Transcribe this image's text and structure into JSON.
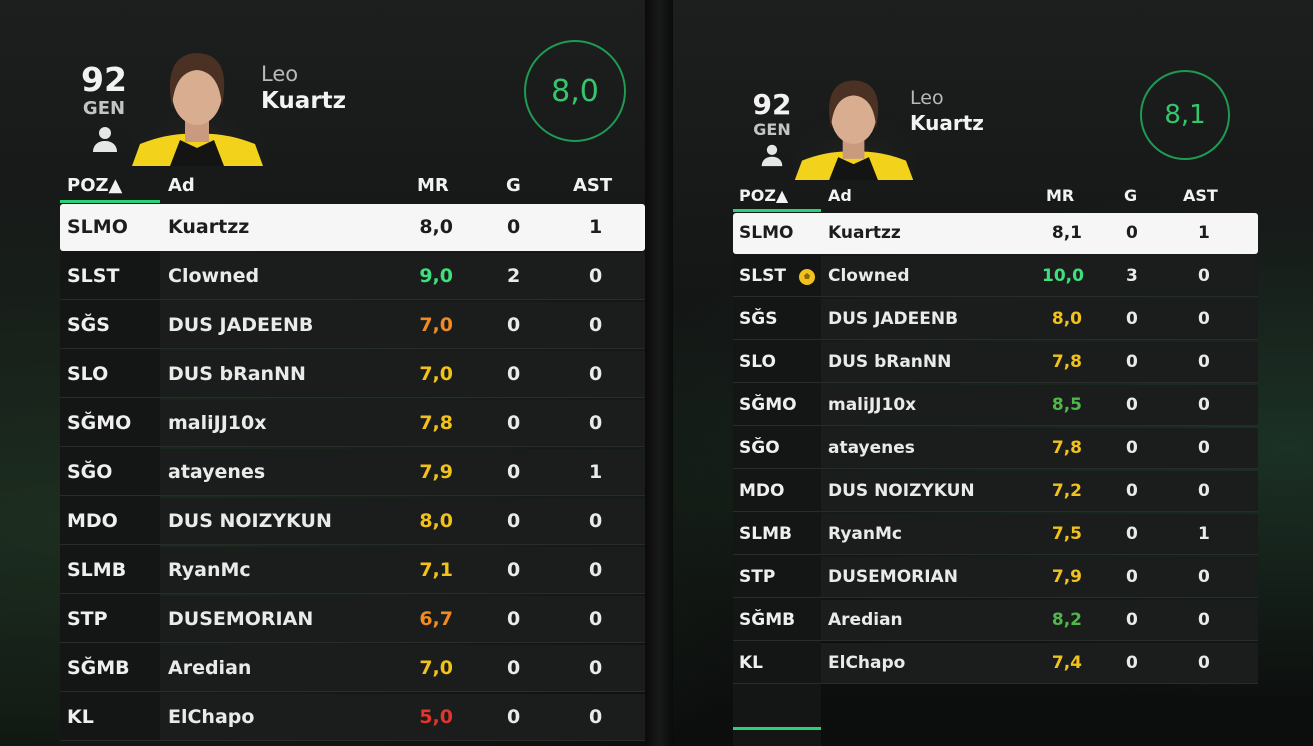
{
  "colors": {
    "rating_green_bright": "#3ee07e",
    "rating_green": "#4fb84a",
    "rating_yellow": "#f1c21b",
    "rating_orange": "#f08a22",
    "rating_red": "#e2352d",
    "accent": "#2ad07a"
  },
  "panels": [
    {
      "player": {
        "overall": "92",
        "overall_label": "GEN",
        "first_name": "Leo",
        "last_name": "Kuartz",
        "match_rating": "8,0"
      },
      "columns": {
        "pos": "POZ▲",
        "name": "Ad",
        "rating": "MR",
        "goals": "G",
        "assists": "AST"
      },
      "rows": [
        {
          "pos": "SLMO",
          "name": "Kuartzz",
          "rating": "8,0",
          "rating_color": "sel",
          "goals": "0",
          "assists": "1",
          "selected": true
        },
        {
          "pos": "SLST",
          "name": "Clowned",
          "rating": "9,0",
          "rating_color": "#3ee07e",
          "goals": "2",
          "assists": "0"
        },
        {
          "pos": "SĞS",
          "name": "DUS JADEENB",
          "rating": "7,0",
          "rating_color": "#f08a22",
          "goals": "0",
          "assists": "0"
        },
        {
          "pos": "SLO",
          "name": "DUS bRanNN",
          "rating": "7,0",
          "rating_color": "#f1c21b",
          "goals": "0",
          "assists": "0"
        },
        {
          "pos": "SĞMO",
          "name": "maliJJ10x",
          "rating": "7,8",
          "rating_color": "#f1c21b",
          "goals": "0",
          "assists": "0"
        },
        {
          "pos": "SĞO",
          "name": "atayenes",
          "rating": "7,9",
          "rating_color": "#f1c21b",
          "goals": "0",
          "assists": "1"
        },
        {
          "pos": "MDO",
          "name": "DUS NOIZYKUN",
          "rating": "8,0",
          "rating_color": "#f1c21b",
          "goals": "0",
          "assists": "0"
        },
        {
          "pos": "SLMB",
          "name": "RyanMc",
          "rating": "7,1",
          "rating_color": "#f1c21b",
          "goals": "0",
          "assists": "0"
        },
        {
          "pos": "STP",
          "name": "DUSEMORIAN",
          "rating": "6,7",
          "rating_color": "#f08a22",
          "goals": "0",
          "assists": "0"
        },
        {
          "pos": "SĞMB",
          "name": "Aredian",
          "rating": "7,0",
          "rating_color": "#f1c21b",
          "goals": "0",
          "assists": "0"
        },
        {
          "pos": "KL",
          "name": "ElChapo",
          "rating": "5,0",
          "rating_color": "#e2352d",
          "goals": "0",
          "assists": "0"
        }
      ]
    },
    {
      "player": {
        "overall": "92",
        "overall_label": "GEN",
        "first_name": "Leo",
        "last_name": "Kuartz",
        "match_rating": "8,1"
      },
      "columns": {
        "pos": "POZ▲",
        "name": "Ad",
        "rating": "MR",
        "goals": "G",
        "assists": "AST"
      },
      "rows": [
        {
          "pos": "SLMO",
          "name": "Kuartzz",
          "rating": "8,1",
          "rating_color": "sel",
          "goals": "0",
          "assists": "1",
          "selected": true
        },
        {
          "pos": "SLST",
          "name": "Clowned",
          "rating": "10,0",
          "rating_color": "#3ee07e",
          "goals": "3",
          "assists": "0",
          "icon": "motm-ball-icon"
        },
        {
          "pos": "SĞS",
          "name": "DUS JADEENB",
          "rating": "8,0",
          "rating_color": "#f1c21b",
          "goals": "0",
          "assists": "0"
        },
        {
          "pos": "SLO",
          "name": "DUS bRanNN",
          "rating": "7,8",
          "rating_color": "#f1c21b",
          "goals": "0",
          "assists": "0"
        },
        {
          "pos": "SĞMO",
          "name": "maliJJ10x",
          "rating": "8,5",
          "rating_color": "#4fb84a",
          "goals": "0",
          "assists": "0"
        },
        {
          "pos": "SĞO",
          "name": "atayenes",
          "rating": "7,8",
          "rating_color": "#f1c21b",
          "goals": "0",
          "assists": "0"
        },
        {
          "pos": "MDO",
          "name": "DUS NOIZYKUN",
          "rating": "7,2",
          "rating_color": "#f1c21b",
          "goals": "0",
          "assists": "0"
        },
        {
          "pos": "SLMB",
          "name": "RyanMc",
          "rating": "7,5",
          "rating_color": "#f1c21b",
          "goals": "0",
          "assists": "1"
        },
        {
          "pos": "STP",
          "name": "DUSEMORIAN",
          "rating": "7,9",
          "rating_color": "#f1c21b",
          "goals": "0",
          "assists": "0"
        },
        {
          "pos": "SĞMB",
          "name": "Aredian",
          "rating": "8,2",
          "rating_color": "#4fb84a",
          "goals": "0",
          "assists": "0"
        },
        {
          "pos": "KL",
          "name": "ElChapo",
          "rating": "7,4",
          "rating_color": "#f1c21b",
          "goals": "0",
          "assists": "0"
        }
      ]
    }
  ]
}
